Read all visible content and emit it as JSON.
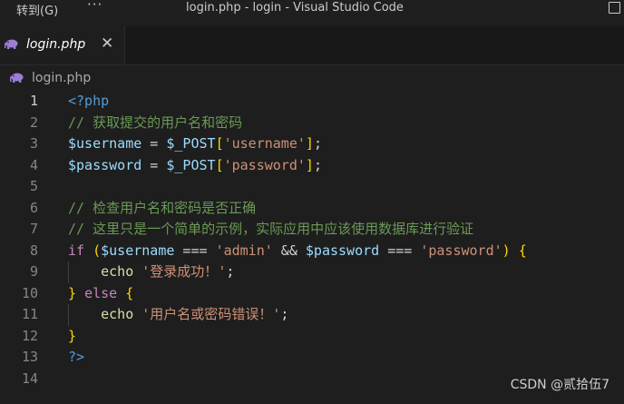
{
  "titlebar": {
    "menu_goto": "转到(G)",
    "menu_more": "···",
    "window_title": "login.php - login - Visual Studio Code"
  },
  "tab": {
    "icon": "php-elephant-icon",
    "label": "login.php",
    "close": "✕"
  },
  "breadcrumb": {
    "icon": "php-elephant-icon",
    "label": "login.php"
  },
  "editor": {
    "active_line": 1,
    "lines": [
      {
        "n": "1",
        "tokens": [
          [
            "tag",
            "<?php"
          ]
        ]
      },
      {
        "n": "2",
        "tokens": [
          [
            "cmt",
            "// 获取提交的用户名和密码"
          ]
        ]
      },
      {
        "n": "3",
        "tokens": [
          [
            "var",
            "$username"
          ],
          [
            "op",
            " = "
          ],
          [
            "var",
            "$_POST"
          ],
          [
            "brk",
            "["
          ],
          [
            "str",
            "'username'"
          ],
          [
            "brk",
            "]"
          ],
          [
            "op",
            ";"
          ]
        ]
      },
      {
        "n": "4",
        "tokens": [
          [
            "var",
            "$password"
          ],
          [
            "op",
            " = "
          ],
          [
            "var",
            "$_POST"
          ],
          [
            "brk",
            "["
          ],
          [
            "str",
            "'password'"
          ],
          [
            "brk",
            "]"
          ],
          [
            "op",
            ";"
          ]
        ]
      },
      {
        "n": "5",
        "tokens": []
      },
      {
        "n": "6",
        "tokens": [
          [
            "cmt",
            "// 检查用户名和密码是否正确"
          ]
        ]
      },
      {
        "n": "7",
        "tokens": [
          [
            "cmt",
            "// 这里只是一个简单的示例，实际应用中应该使用数据库进行验证"
          ]
        ]
      },
      {
        "n": "8",
        "tokens": [
          [
            "kw",
            "if"
          ],
          [
            "op",
            " "
          ],
          [
            "brk",
            "("
          ],
          [
            "var",
            "$username"
          ],
          [
            "op",
            " === "
          ],
          [
            "str",
            "'admin'"
          ],
          [
            "op",
            " && "
          ],
          [
            "var",
            "$password"
          ],
          [
            "op",
            " === "
          ],
          [
            "str",
            "'password'"
          ],
          [
            "brk",
            ")"
          ],
          [
            "op",
            " "
          ],
          [
            "brk",
            "{"
          ]
        ]
      },
      {
        "n": "9",
        "tokens": [
          [
            "op",
            "    "
          ],
          [
            "fn",
            "echo"
          ],
          [
            "op",
            " "
          ],
          [
            "str",
            "'登录成功！'"
          ],
          [
            "op",
            ";"
          ]
        ]
      },
      {
        "n": "10",
        "tokens": [
          [
            "brk",
            "}"
          ],
          [
            "op",
            " "
          ],
          [
            "kw",
            "else"
          ],
          [
            "op",
            " "
          ],
          [
            "brk",
            "{"
          ]
        ]
      },
      {
        "n": "11",
        "tokens": [
          [
            "op",
            "    "
          ],
          [
            "fn",
            "echo"
          ],
          [
            "op",
            " "
          ],
          [
            "str",
            "'用户名或密码错误！'"
          ],
          [
            "op",
            ";"
          ]
        ]
      },
      {
        "n": "12",
        "tokens": [
          [
            "brk",
            "}"
          ]
        ]
      },
      {
        "n": "13",
        "tokens": [
          [
            "tag",
            "?>"
          ]
        ]
      },
      {
        "n": "14",
        "tokens": []
      }
    ]
  },
  "watermark": "CSDN @贰拾伍7",
  "colors": {
    "background": "#1e1e1e",
    "tag": "#569cd6",
    "comment": "#6a9955",
    "variable": "#9cdcfe",
    "string": "#ce9178",
    "keyword": "#c586c0",
    "bracket": "#ffd700",
    "function": "#dcdcaa"
  }
}
